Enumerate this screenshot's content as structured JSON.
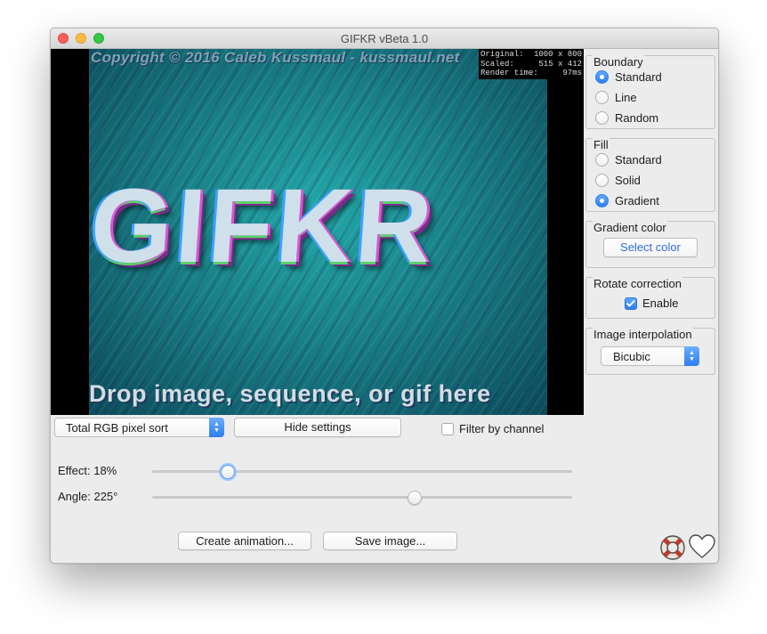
{
  "window": {
    "title": "GIFKR vBeta 1.0"
  },
  "preview": {
    "copyright_text": "Copyright © 2016 Caleb Kussmaul - kussmaul.net",
    "logo_text": "GIFKR",
    "drop_hint": "Drop image, sequence, or gif here",
    "stats": [
      {
        "label": "Original:",
        "value": "1000 x 800"
      },
      {
        "label": "Scaled:",
        "value": "515 x 412"
      },
      {
        "label": "Render time:",
        "value": "97ms"
      }
    ]
  },
  "boundary": {
    "title": "Boundary",
    "options": [
      "Standard",
      "Line",
      "Random"
    ],
    "selected": "Standard"
  },
  "fill": {
    "title": "Fill",
    "options": [
      "Standard",
      "Solid",
      "Gradient"
    ],
    "selected": "Gradient"
  },
  "gradient_color": {
    "title": "Gradient color",
    "button": "Select color"
  },
  "rotate_correction": {
    "title": "Rotate correction",
    "enable_label": "Enable",
    "enabled": true
  },
  "image_interpolation": {
    "title": "Image interpolation",
    "selected": "Bicubic"
  },
  "controls": {
    "algorithm": "Total RGB pixel sort",
    "hide_settings": "Hide settings",
    "filter_by_channel": "Filter by channel",
    "filter_checked": false
  },
  "effect": {
    "label": "Effect: 18%",
    "value": 0.18
  },
  "angle": {
    "label": "Angle: 225°",
    "value": 0.625
  },
  "buttons": {
    "create_animation": "Create animation...",
    "save_image": "Save image..."
  },
  "icons": {
    "help": "lifebuoy-icon",
    "donate": "heart-icon"
  },
  "colors": {
    "accent": "#2d7ff0",
    "window_bg": "#ececec"
  }
}
